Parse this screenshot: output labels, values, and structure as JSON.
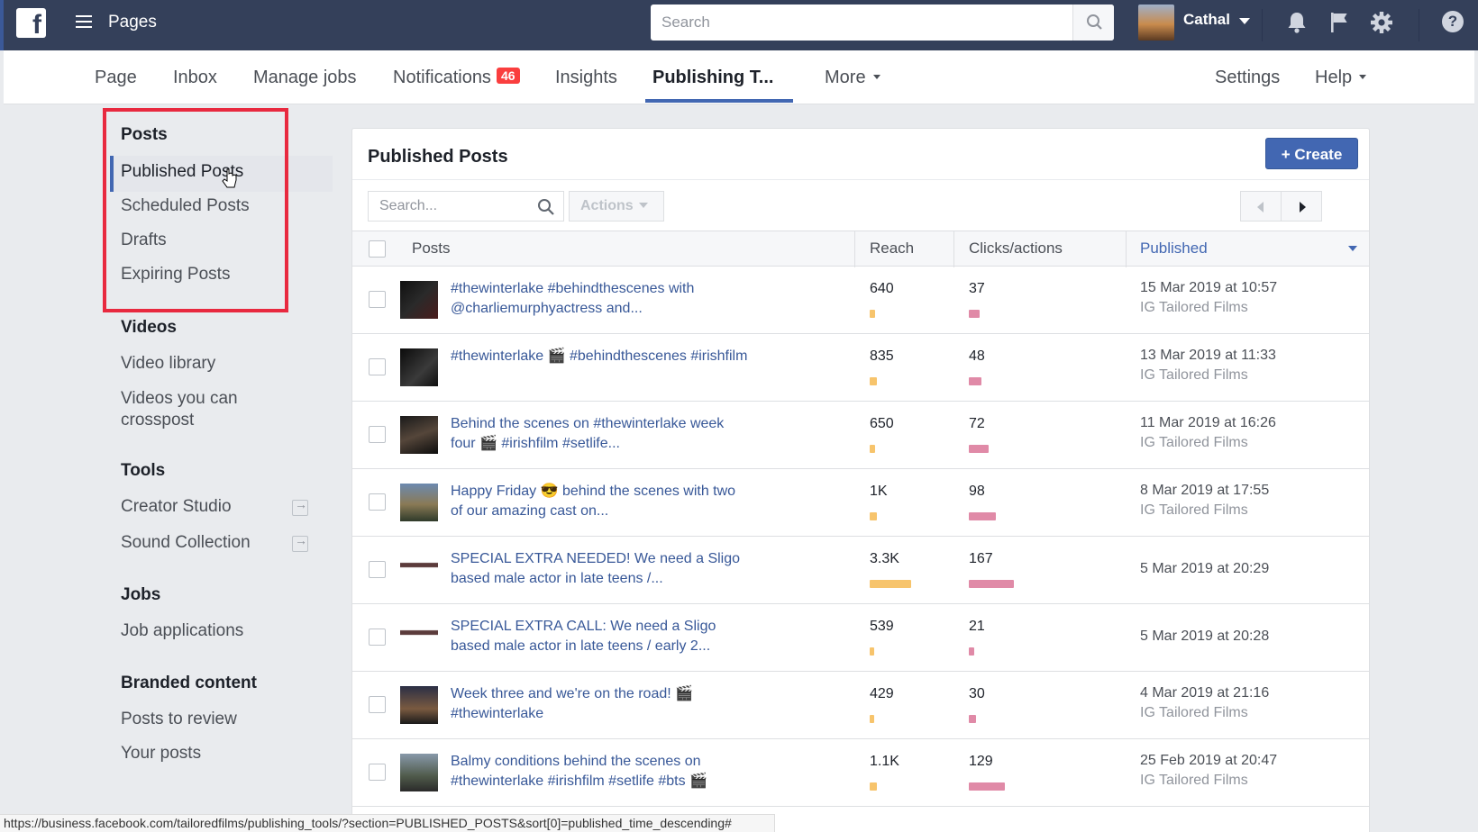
{
  "topbar": {
    "logo": "f",
    "section": "Pages",
    "search_placeholder": "Search",
    "user_name": "Cathal",
    "help": "?"
  },
  "tabs": [
    {
      "label": "Page"
    },
    {
      "label": "Inbox"
    },
    {
      "label": "Manage jobs"
    },
    {
      "label": "Notifications",
      "badge": "46"
    },
    {
      "label": "Insights"
    },
    {
      "label": "Publishing T..."
    },
    {
      "label": "More"
    },
    {
      "label": "Settings"
    },
    {
      "label": "Help"
    }
  ],
  "sidebar": {
    "posts_heading": "Posts",
    "posts_items": [
      "Published Posts",
      "Scheduled Posts",
      "Drafts",
      "Expiring Posts"
    ],
    "videos_heading": "Videos",
    "videos_items": [
      "Video library",
      "Videos you can crosspost"
    ],
    "tools_heading": "Tools",
    "tools_items": [
      "Creator Studio",
      "Sound Collection"
    ],
    "jobs_heading": "Jobs",
    "jobs_items": [
      "Job applications"
    ],
    "branded_heading": "Branded content",
    "branded_items": [
      "Posts to review",
      "Your posts"
    ]
  },
  "main": {
    "title": "Published Posts",
    "create_label": "+ Create",
    "search_placeholder": "Search...",
    "actions_label": "Actions",
    "columns": {
      "posts": "Posts",
      "reach": "Reach",
      "clicks": "Clicks/actions",
      "published": "Published"
    }
  },
  "rows": [
    {
      "text": "#thewinterlake #behindthescenes with @charliemurphyactress and...",
      "reach": "640",
      "reach_frac": 0.03,
      "clicks": "37",
      "clicks_frac": 0.06,
      "date": "15 Mar 2019 at 10:57",
      "source": "IG Tailored Films"
    },
    {
      "text": "#thewinterlake 🎬 #behindthescenes #irishfilm",
      "reach": "835",
      "reach_frac": 0.04,
      "clicks": "48",
      "clicks_frac": 0.07,
      "date": "13 Mar 2019 at 11:33",
      "source": "IG Tailored Films"
    },
    {
      "text": "Behind the scenes on #thewinterlake week four 🎬 #irishfilm #setlife...",
      "reach": "650",
      "reach_frac": 0.03,
      "clicks": "72",
      "clicks_frac": 0.11,
      "date": "11 Mar 2019 at 16:26",
      "source": "IG Tailored Films"
    },
    {
      "text": "Happy Friday 😎 behind the scenes with two of our amazing cast on...",
      "reach": "1K",
      "reach_frac": 0.04,
      "clicks": "98",
      "clicks_frac": 0.15,
      "date": "8 Mar 2019 at 17:55",
      "source": "IG Tailored Films"
    },
    {
      "text": "SPECIAL EXTRA NEEDED! We need a Sligo based male actor in late teens /...",
      "reach": "3.3K",
      "reach_frac": 0.23,
      "clicks": "167",
      "clicks_frac": 0.25,
      "date": "5 Mar 2019 at 20:29",
      "source": ""
    },
    {
      "text": "SPECIAL EXTRA CALL: We need a Sligo based male actor in late teens / early 2...",
      "reach": "539",
      "reach_frac": 0.02,
      "clicks": "21",
      "clicks_frac": 0.03,
      "date": "5 Mar 2019 at 20:28",
      "source": ""
    },
    {
      "text": "Week three and we're on the road! 🎬 #thewinterlake",
      "reach": "429",
      "reach_frac": 0.02,
      "clicks": "30",
      "clicks_frac": 0.04,
      "date": "4 Mar 2019 at 21:16",
      "source": "IG Tailored Films"
    },
    {
      "text": "Balmy conditions behind the scenes on #thewinterlake #irishfilm #setlife #bts 🎬",
      "reach": "1.1K",
      "reach_frac": 0.04,
      "clicks": "129",
      "clicks_frac": 0.2,
      "date": "25 Feb 2019 at 20:47",
      "source": "IG Tailored Films"
    }
  ],
  "status_bar": "https://business.facebook.com/tailoredfilms/publishing_tools/?section=PUBLISHED_POSTS&sort[0]=published_time_descending#",
  "colors": {
    "brand": "#4267b2",
    "topbar": "#34405a",
    "highlight": "#e8293f",
    "reach_bar": "#f7c46c",
    "clicks_bar": "#d5638a"
  }
}
